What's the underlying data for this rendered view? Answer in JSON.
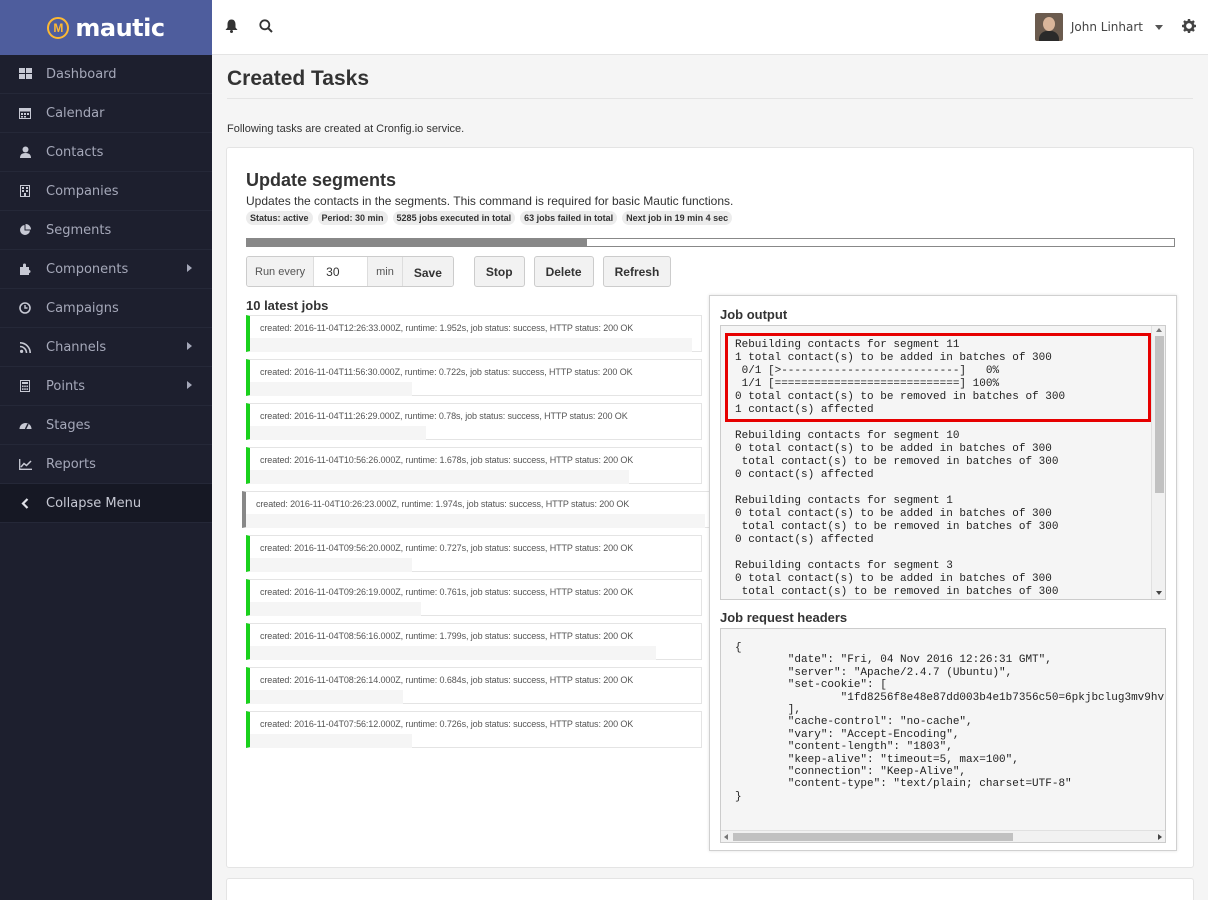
{
  "brand": {
    "name": "mautic",
    "logo_icon": "mautic-logo-icon",
    "accent": "#4e5d9d",
    "logo_color": "#fdb933"
  },
  "sidebar": {
    "items": [
      {
        "label": "Dashboard",
        "icon": "dashboard-icon"
      },
      {
        "label": "Calendar",
        "icon": "calendar-icon"
      },
      {
        "label": "Contacts",
        "icon": "user-icon"
      },
      {
        "label": "Companies",
        "icon": "building-icon"
      },
      {
        "label": "Segments",
        "icon": "pie-chart-icon"
      },
      {
        "label": "Components",
        "icon": "puzzle-icon",
        "submenu": true
      },
      {
        "label": "Campaigns",
        "icon": "clock-icon"
      },
      {
        "label": "Channels",
        "icon": "rss-icon",
        "submenu": true
      },
      {
        "label": "Points",
        "icon": "calculator-icon",
        "submenu": true
      },
      {
        "label": "Stages",
        "icon": "tachometer-icon"
      },
      {
        "label": "Reports",
        "icon": "line-chart-icon"
      }
    ],
    "collapse_label": "Collapse Menu"
  },
  "topbar": {
    "user_name": "John Linhart"
  },
  "page": {
    "title": "Created Tasks",
    "intro": "Following tasks are created at Cronfig.io service."
  },
  "task": {
    "title": "Update segments",
    "description": "Updates the contacts in the segments. This command is required for basic Mautic functions.",
    "badges": [
      "Status: active",
      "Period: 30 min",
      "5285 jobs executed in total",
      "63 jobs failed in total",
      "Next job in 19 min 4 sec"
    ],
    "progress_fraction": 0.367,
    "controls": {
      "run_every_label": "Run every",
      "interval_value": "30",
      "unit_label": "min",
      "save_label": "Save",
      "stop_label": "Stop",
      "delete_label": "Delete",
      "refresh_label": "Refresh"
    }
  },
  "jobs": {
    "title": "10 latest jobs",
    "success_color": "#19d11c",
    "items": [
      {
        "text": "created: 2016-11-04T12:26:33.000Z, runtime: 1.952s, job status: success, HTTP status: 200 OK",
        "runtime_fraction": 0.98
      },
      {
        "text": "created: 2016-11-04T11:56:30.000Z, runtime: 0.722s, job status: success, HTTP status: 200 OK",
        "runtime_fraction": 0.36
      },
      {
        "text": "created: 2016-11-04T11:26:29.000Z, runtime: 0.78s, job status: success, HTTP status: 200 OK",
        "runtime_fraction": 0.39
      },
      {
        "text": "created: 2016-11-04T10:56:26.000Z, runtime: 1.678s, job status: success, HTTP status: 200 OK",
        "runtime_fraction": 0.84
      },
      {
        "text": "created: 2016-11-04T10:26:23.000Z, runtime: 1.974s, job status: success, HTTP status: 200 OK",
        "runtime_fraction": 0.99
      },
      {
        "text": "created: 2016-11-04T09:56:20.000Z, runtime: 0.727s, job status: success, HTTP status: 200 OK",
        "runtime_fraction": 0.36
      },
      {
        "text": "created: 2016-11-04T09:26:19.000Z, runtime: 0.761s, job status: success, HTTP status: 200 OK",
        "runtime_fraction": 0.38
      },
      {
        "text": "created: 2016-11-04T08:56:16.000Z, runtime: 1.799s, job status: success, HTTP status: 200 OK",
        "runtime_fraction": 0.9
      },
      {
        "text": "created: 2016-11-04T08:26:14.000Z, runtime: 0.684s, job status: success, HTTP status: 200 OK",
        "runtime_fraction": 0.34
      },
      {
        "text": "created: 2016-11-04T07:56:12.000Z, runtime: 0.726s, job status: success, HTTP status: 200 OK",
        "runtime_fraction": 0.36
      }
    ]
  },
  "job_output": {
    "title": "Job output",
    "highlight_color": "#e60000",
    "text": "Rebuilding contacts for segment 11\n1 total contact(s) to be added in batches of 300\n 0/1 [>---------------------------]   0%\n 1/1 [============================] 100%\n0 total contact(s) to be removed in batches of 300\n1 contact(s) affected\n\nRebuilding contacts for segment 10\n0 total contact(s) to be added in batches of 300\n total contact(s) to be removed in batches of 300\n0 contact(s) affected\n\nRebuilding contacts for segment 1\n0 total contact(s) to be added in batches of 300\n total contact(s) to be removed in batches of 300\n0 contact(s) affected\n\nRebuilding contacts for segment 3\n0 total contact(s) to be added in batches of 300\n total contact(s) to be removed in batches of 300"
  },
  "job_headers": {
    "title": "Job request headers",
    "text": "{\n        \"date\": \"Fri, 04 Nov 2016 12:26:31 GMT\",\n        \"server\": \"Apache/2.4.7 (Ubuntu)\",\n        \"set-cookie\": [\n                \"1fd8256f8e48e87dd003b4e1b7356c50=6pkjbclug3mv9hv\n        ],\n        \"cache-control\": \"no-cache\",\n        \"vary\": \"Accept-Encoding\",\n        \"content-length\": \"1803\",\n        \"keep-alive\": \"timeout=5, max=100\",\n        \"connection\": \"Keep-Alive\",\n        \"content-type\": \"text/plain; charset=UTF-8\"\n}"
  }
}
